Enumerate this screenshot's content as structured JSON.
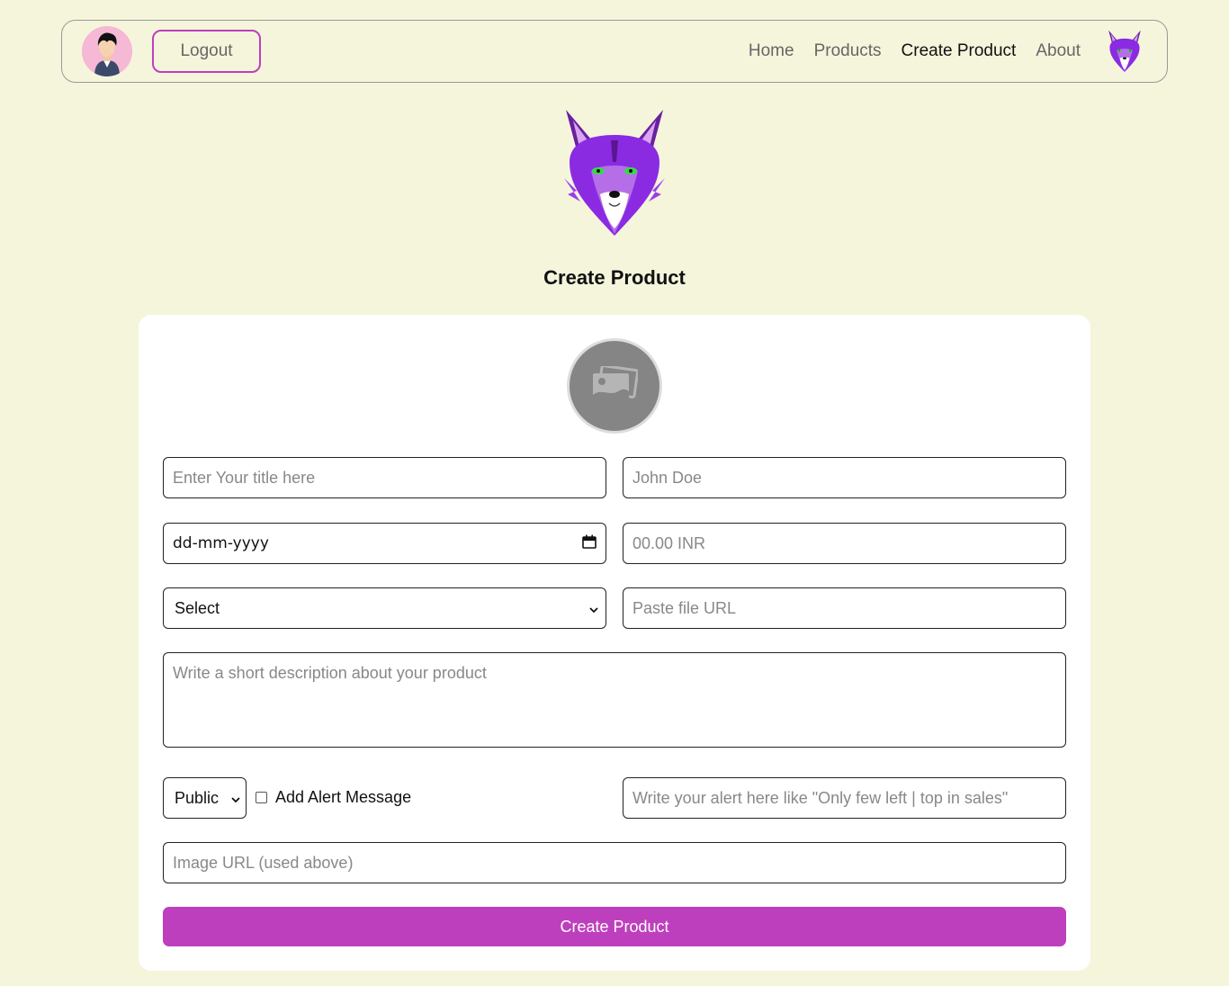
{
  "navbar": {
    "logout_label": "Logout",
    "links": [
      {
        "label": "Home"
      },
      {
        "label": "Products"
      },
      {
        "label": "Create Product"
      },
      {
        "label": "About"
      }
    ],
    "active_link": "Create Product"
  },
  "page": {
    "title": "Create Product"
  },
  "form": {
    "title_placeholder": "Enter Your title here",
    "author_placeholder": "John Doe",
    "date_value": "dd-mm-yyyy",
    "price_placeholder": "00.00 INR",
    "category_value": "Select",
    "file_url_placeholder": "Paste file URL",
    "description_placeholder": "Write a short description about your product",
    "visibility_value": "Public",
    "alert_checkbox_label": "Add Alert Message",
    "alert_checked": false,
    "alert_placeholder": "Write your alert here like \"Only few left | top in sales\"",
    "image_url_placeholder": "Image URL (used above)",
    "submit_label": "Create Product"
  },
  "colors": {
    "background": "#f5f5dc",
    "accent": "#be3fbd",
    "card": "#ffffff"
  },
  "icons": {
    "avatar": "user-avatar-icon",
    "brand": "purple-fox-logo",
    "preview": "image-placeholder-icon",
    "date": "calendar-icon",
    "dropdown": "chevron-down-icon"
  }
}
